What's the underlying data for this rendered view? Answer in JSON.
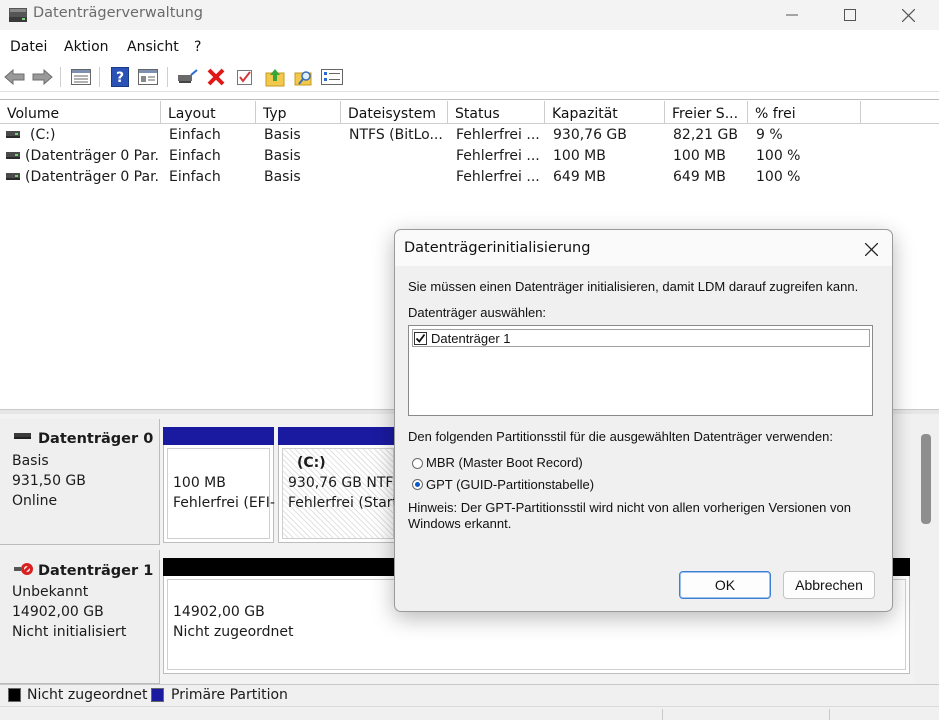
{
  "window": {
    "title": "Datenträgerverwaltung",
    "controls": [
      "minimize",
      "maximize",
      "close"
    ]
  },
  "menu": [
    "Datei",
    "Aktion",
    "Ansicht",
    "?"
  ],
  "toolbar_icons": [
    "back-arrow-icon",
    "forward-arrow-icon",
    "list-view-icon",
    "help-icon",
    "properties-icon",
    "connect-icon",
    "delete-icon",
    "check-icon",
    "folder-up-icon",
    "folder-search-icon",
    "list-details-icon"
  ],
  "volume_list": {
    "columns": [
      "Volume",
      "Layout",
      "Typ",
      "Dateisystem",
      "Status",
      "Kapazität",
      "Freier S...",
      "% frei"
    ],
    "rows": [
      {
        "volume": "(C:)",
        "layout": "Einfach",
        "typ": "Basis",
        "dateisystem": "NTFS (BitLo...",
        "status": "Fehlerfrei ...",
        "kapazitaet": "930,76 GB",
        "frei": "82,21 GB",
        "prozent": "9 %"
      },
      {
        "volume": "(Datenträger 0 Par...",
        "layout": "Einfach",
        "typ": "Basis",
        "dateisystem": "",
        "status": "Fehlerfrei ...",
        "kapazitaet": "100 MB",
        "frei": "100 MB",
        "prozent": "100 %"
      },
      {
        "volume": "(Datenträger 0 Par...",
        "layout": "Einfach",
        "typ": "Basis",
        "dateisystem": "",
        "status": "Fehlerfrei ...",
        "kapazitaet": "649 MB",
        "frei": "649 MB",
        "prozent": "100 %"
      }
    ]
  },
  "disks": [
    {
      "name": "Datenträger 0",
      "type": "Basis",
      "size": "931,50 GB",
      "state": "Online",
      "partitions": [
        {
          "size": "100 MB",
          "status": "Fehlerfrei (EFI-"
        },
        {
          "label": "(C:)",
          "size": "930,76 GB NTFS",
          "status": "Fehlerfrei (Startp"
        }
      ]
    },
    {
      "name": "Datenträger 1",
      "type": "Unbekannt",
      "size": "14902,00 GB",
      "state": "Nicht initialisiert",
      "partitions": [
        {
          "size": "14902,00 GB",
          "status": "Nicht zugeordnet"
        }
      ]
    }
  ],
  "legend": [
    {
      "label": "Nicht zugeordnet",
      "color": "#000000"
    },
    {
      "label": "Primäre Partition",
      "color": "#1a1aa0"
    }
  ],
  "dialog": {
    "title": "Datenträgerinitialisierung",
    "intro": "Sie müssen einen Datenträger initialisieren, damit LDM darauf zugreifen kann.",
    "select_label": "Datenträger auswählen:",
    "disk_items": [
      {
        "label": "Datenträger 1",
        "checked": true
      }
    ],
    "style_label": "Den folgenden Partitionsstil für die ausgewählten Datenträger verwenden:",
    "options": [
      {
        "label": "MBR (Master Boot Record)",
        "selected": false
      },
      {
        "label": "GPT (GUID-Partitionstabelle)",
        "selected": true
      }
    ],
    "hint_line1": "Hinweis: Der GPT-Partitionsstil wird nicht von allen vorherigen Versionen von",
    "hint_line2": "Windows erkannt.",
    "ok_label": "OK",
    "cancel_label": "Abbrechen"
  },
  "colors": {
    "primary_partition": "#1a1aa0",
    "unallocated": "#000000",
    "accent": "#0a59c8"
  }
}
